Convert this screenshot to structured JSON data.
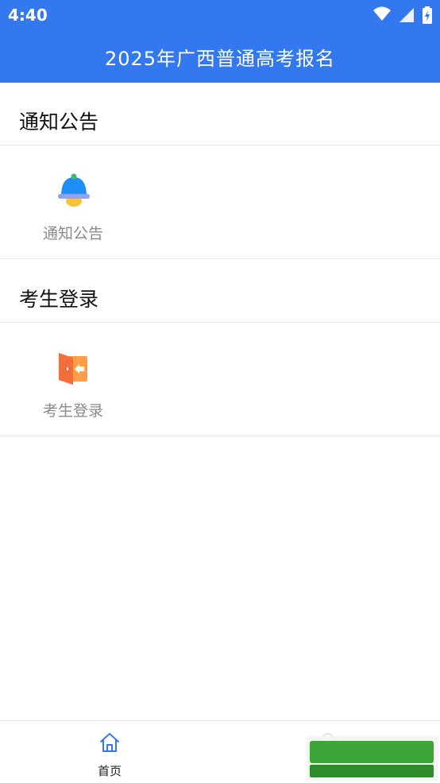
{
  "status_bar": {
    "time": "4:40"
  },
  "app_bar": {
    "title": "2025年广西普通高考报名"
  },
  "sections": [
    {
      "title": "通知公告",
      "items": [
        {
          "label": "通知公告",
          "icon": "bell-icon"
        }
      ]
    },
    {
      "title": "考生登录",
      "items": [
        {
          "label": "考生登录",
          "icon": "door-exit-icon"
        }
      ]
    }
  ],
  "tab_bar": {
    "home_label": "首页",
    "home_icon": "home-icon",
    "other_icon": "user-icon"
  },
  "colors": {
    "primary": "#3478f0",
    "bell_body": "#1e8ff5",
    "bell_band": "#8fa2f5",
    "bell_clapper": "#f6c33b",
    "bell_top": "#3dbb6b",
    "door_dark": "#f36e3d",
    "door_light": "#ff9e47"
  }
}
